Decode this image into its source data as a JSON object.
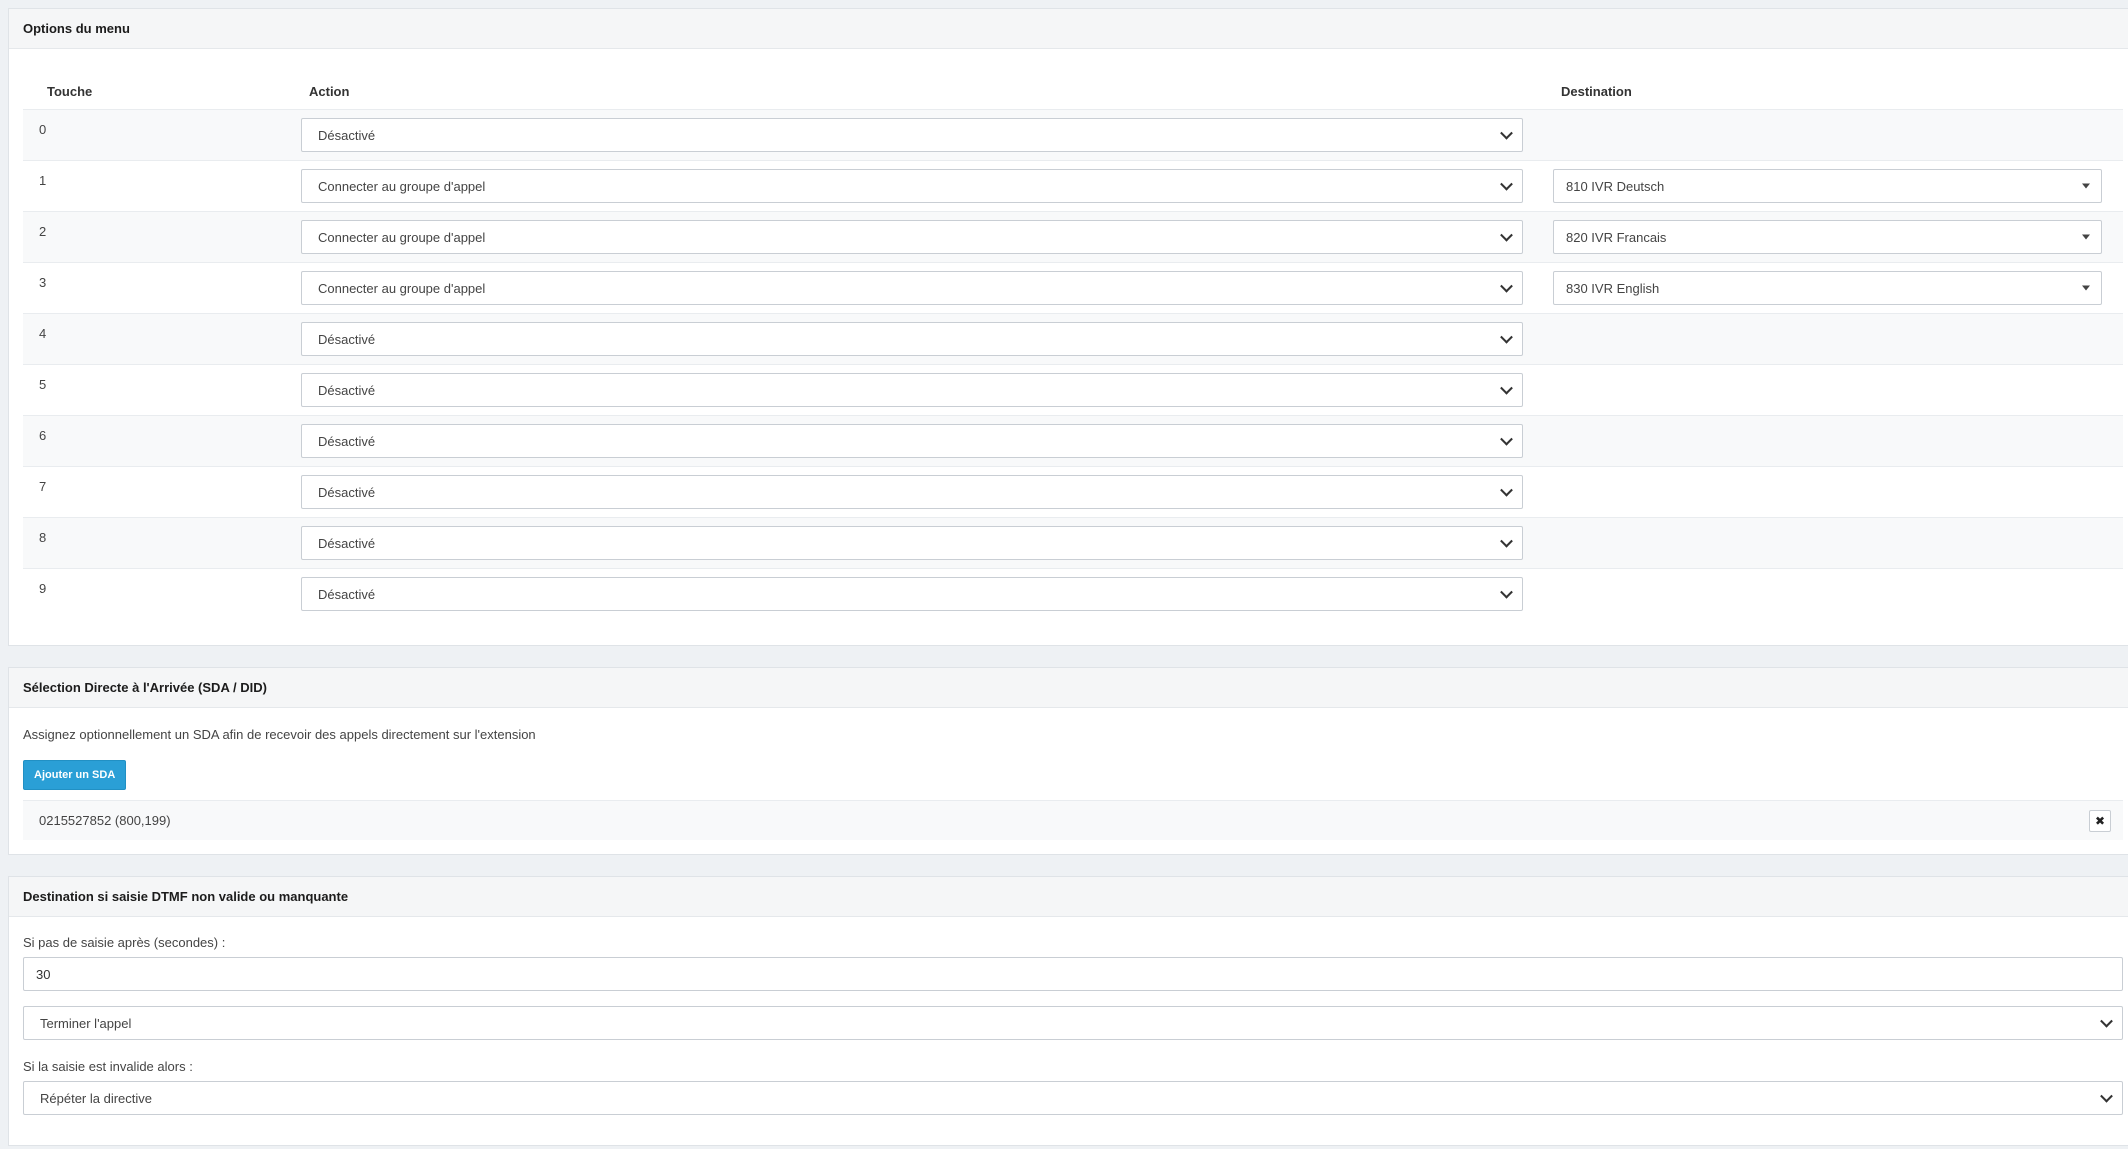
{
  "menu_options": {
    "title": "Options du menu",
    "columns": {
      "key": "Touche",
      "action": "Action",
      "destination": "Destination"
    },
    "rows": [
      {
        "key": "0",
        "action": "Désactivé",
        "destination": ""
      },
      {
        "key": "1",
        "action": "Connecter au groupe d'appel",
        "destination": "810 IVR Deutsch"
      },
      {
        "key": "2",
        "action": "Connecter au groupe d'appel",
        "destination": "820 IVR Francais"
      },
      {
        "key": "3",
        "action": "Connecter au groupe d'appel",
        "destination": "830 IVR English"
      },
      {
        "key": "4",
        "action": "Désactivé",
        "destination": ""
      },
      {
        "key": "5",
        "action": "Désactivé",
        "destination": ""
      },
      {
        "key": "6",
        "action": "Désactivé",
        "destination": ""
      },
      {
        "key": "7",
        "action": "Désactivé",
        "destination": ""
      },
      {
        "key": "8",
        "action": "Désactivé",
        "destination": ""
      },
      {
        "key": "9",
        "action": "Désactivé",
        "destination": ""
      }
    ]
  },
  "sda": {
    "title": "Sélection Directe à l'Arrivée (SDA / DID)",
    "description": "Assignez optionnellement un SDA afin de recevoir des appels directement sur l'extension",
    "add_button": "Ajouter un SDA",
    "entries": [
      {
        "number": "0215527852 (800,199)",
        "delete_icon": "close-icon"
      }
    ]
  },
  "dtmf": {
    "title": "Destination si saisie DTMF non valide ou manquante",
    "timeout_label": "Si pas de saisie après (secondes) :",
    "timeout_value": "30",
    "timeout_action": "Terminer l'appel",
    "invalid_label": "Si la saisie est invalide alors :",
    "invalid_action": "Répéter la directive"
  },
  "colors": {
    "primary_button": "#2a9fd6",
    "panel_header": "#f5f6f7",
    "page_background": "#eef1f4"
  }
}
